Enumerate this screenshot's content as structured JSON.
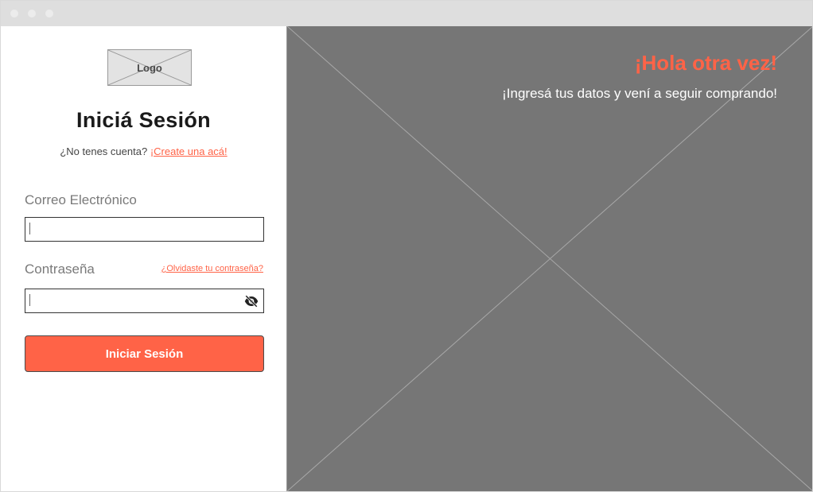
{
  "logo": {
    "text": "Logo"
  },
  "login": {
    "title": "Iniciá Sesión",
    "signup_prompt": "¿No tenes cuenta?",
    "signup_link": "¡Create una acá!",
    "email_label": "Correo Electrónico",
    "email_value": "",
    "password_label": "Contraseña",
    "password_value": "",
    "forgot_link": "¿Olvidaste tu contraseña?",
    "password_toggle_icon": "eye-off-icon",
    "submit_label": "Iniciar Sesión"
  },
  "hero": {
    "title": "¡Hola otra vez!",
    "subtitle": "¡Ingresá tus datos y vení a seguir comprando!"
  },
  "colors": {
    "accent": "#ff6347",
    "placeholder_panel": "#767676",
    "titlebar": "#dedede"
  }
}
